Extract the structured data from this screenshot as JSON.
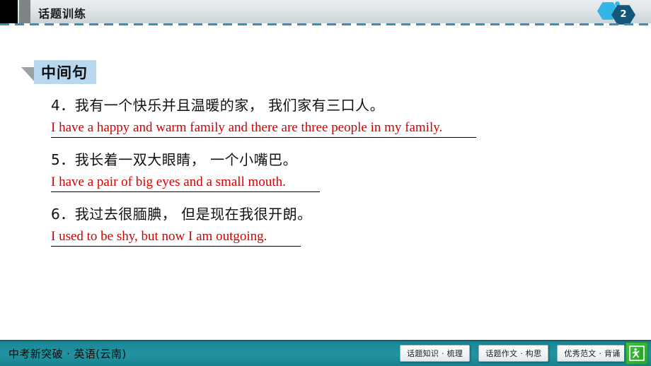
{
  "header": {
    "title": "话题训练",
    "badge_number": "2",
    "badge_icons": [
      "hexagon-light-icon",
      "hexagon-dark-icon"
    ]
  },
  "section": {
    "title": "中间句"
  },
  "items": [
    {
      "number": "4",
      "chinese": "4．我有一个快乐并且温暖的家， 我们家有三口人。",
      "english": "I have a happy and warm family and there are three people in my family."
    },
    {
      "number": "5",
      "chinese": "5．我长着一双大眼睛， 一个小嘴巴。",
      "english": "I have a pair of big eyes and a small mouth."
    },
    {
      "number": "6",
      "chinese": "6．我过去很腼腆， 但是现在我很开朗。",
      "english": "I used to be shy, but now I am outgoing."
    }
  ],
  "footer": {
    "brand": "中考新突破 · 英语(云南)",
    "buttons": [
      "话题知识 · 梳理",
      "话题作文 · 构思",
      "优秀范文 · 背诵"
    ],
    "exit_icon": "exit-running-man-icon"
  },
  "colors": {
    "accent_red": "#d60000",
    "header_bg": "#dfe5e8",
    "footer_teal": "#2393a1",
    "section_blue": "#b8d8f0",
    "dash_blue": "#3a8fbf"
  }
}
